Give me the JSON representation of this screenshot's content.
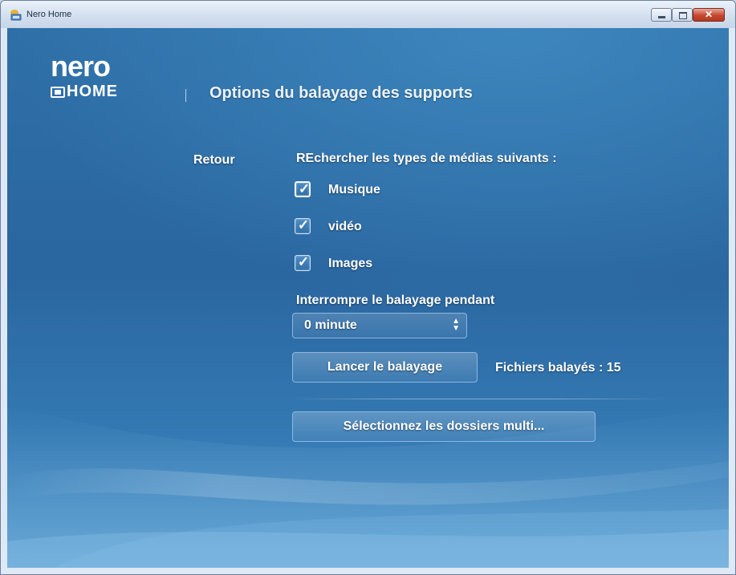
{
  "window": {
    "title": "Nero Home",
    "controls": {
      "minimize": "minimize",
      "maximize": "maximize",
      "close_label": "✕"
    }
  },
  "logo": {
    "brand": "nero",
    "product": "HOME"
  },
  "header": {
    "title": "Options du balayage des supports"
  },
  "nav": {
    "back_label": "Retour"
  },
  "media_types": {
    "heading": "REchercher les types de médias suivants :",
    "items": [
      {
        "label": "Musique",
        "checked": true
      },
      {
        "label": "vidéo",
        "checked": true
      },
      {
        "label": "Images",
        "checked": true
      }
    ]
  },
  "interrupt": {
    "heading": "Interrompre le balayage pendant",
    "selected": "0 minute"
  },
  "scan": {
    "button_label": "Lancer le balayage",
    "status": "Fichiers balayés : 15"
  },
  "folders": {
    "button_label": "Sélectionnez les dossiers multi..."
  },
  "colors": {
    "background": "#2f6fa8",
    "text": "#ffffff",
    "close_button": "#c7462e"
  },
  "icons": {
    "app": "nero-home-icon",
    "check": "checkmark-icon",
    "select": "spinner-arrows-icon"
  }
}
